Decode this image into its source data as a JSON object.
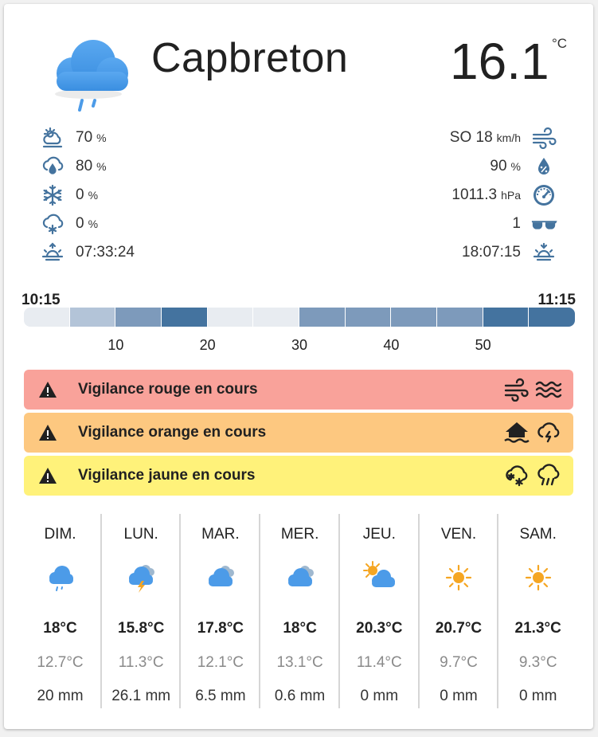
{
  "header": {
    "city": "Capbreton",
    "temperature": "16.1",
    "unit": "°C"
  },
  "attributes_left": [
    {
      "icon": "weather-partly-cloudy-icon",
      "value": "70",
      "unit": "%"
    },
    {
      "icon": "cloud-percent-icon",
      "value": "80",
      "unit": "%"
    },
    {
      "icon": "snowflake-icon",
      "value": "0",
      "unit": "%"
    },
    {
      "icon": "snowy-cloud-icon",
      "value": "0",
      "unit": "%"
    },
    {
      "icon": "sunrise-icon",
      "value": "07:33:24",
      "unit": ""
    }
  ],
  "attributes_right": [
    {
      "icon": "wind-icon",
      "value": "SO 18",
      "unit": "km/h"
    },
    {
      "icon": "humidity-icon",
      "value": "90",
      "unit": "%"
    },
    {
      "icon": "gauge-icon",
      "value": "1011.3",
      "unit": "hPa"
    },
    {
      "icon": "sunglasses-icon",
      "value": "1",
      "unit": ""
    },
    {
      "icon": "sunset-icon",
      "value": "18:07:15",
      "unit": ""
    }
  ],
  "rain_forecast": {
    "start_time": "10:15",
    "end_time": "11:15",
    "ticks": [
      "10",
      "20",
      "30",
      "40",
      "50"
    ],
    "segments": [
      {
        "intensity": 1,
        "color": "#e8ecf1"
      },
      {
        "intensity": 2,
        "color": "#b3c4d8"
      },
      {
        "intensity": 3,
        "color": "#7d9abb"
      },
      {
        "intensity": 4,
        "color": "#44739f"
      },
      {
        "intensity": 1,
        "color": "#e8ecf1"
      },
      {
        "intensity": 1,
        "color": "#e8ecf1"
      },
      {
        "intensity": 3,
        "color": "#7d9abb"
      },
      {
        "intensity": 3,
        "color": "#7d9abb"
      },
      {
        "intensity": 3,
        "color": "#7d9abb"
      },
      {
        "intensity": 3,
        "color": "#7d9abb"
      },
      {
        "intensity": 4,
        "color": "#44739f"
      },
      {
        "intensity": 4,
        "color": "#44739f"
      }
    ]
  },
  "alerts": [
    {
      "text": "Vigilance rouge en cours",
      "color": "#f9a29a",
      "icons": [
        "wind-icon",
        "waves-icon"
      ]
    },
    {
      "text": "Vigilance orange en cours",
      "color": "#fdc880",
      "icons": [
        "home-flood-icon",
        "thunderstorm-cloud-icon"
      ]
    },
    {
      "text": "Vigilance jaune en cours",
      "color": "#fff27a",
      "icons": [
        "snowy-cloud-icon",
        "pouring-rain-icon"
      ]
    }
  ],
  "forecast": [
    {
      "day": "DIM.",
      "icon": "rainy-cloud-icon",
      "high": "18°C",
      "low": "12.7°C",
      "precip": "20 mm"
    },
    {
      "day": "LUN.",
      "icon": "thunderstorm-cloud-icon",
      "high": "15.8°C",
      "low": "11.3°C",
      "precip": "26.1 mm"
    },
    {
      "day": "MAR.",
      "icon": "cloudy-icon",
      "high": "17.8°C",
      "low": "12.1°C",
      "precip": "6.5 mm"
    },
    {
      "day": "MER.",
      "icon": "cloudy-icon",
      "high": "18°C",
      "low": "13.1°C",
      "precip": "0.6 mm"
    },
    {
      "day": "JEU.",
      "icon": "partly-sunny-icon",
      "high": "20.3°C",
      "low": "11.4°C",
      "precip": "0 mm"
    },
    {
      "day": "VEN.",
      "icon": "sun-icon",
      "high": "20.7°C",
      "low": "9.7°C",
      "precip": "0 mm"
    },
    {
      "day": "SAM.",
      "icon": "sun-icon",
      "high": "21.3°C",
      "low": "9.3°C",
      "precip": "0 mm"
    }
  ],
  "colors": {
    "icon_blue": "#44739e",
    "cloud_blue": "#4c9be8",
    "sun_orange": "#f5a623",
    "bolt": "#f5a623"
  }
}
